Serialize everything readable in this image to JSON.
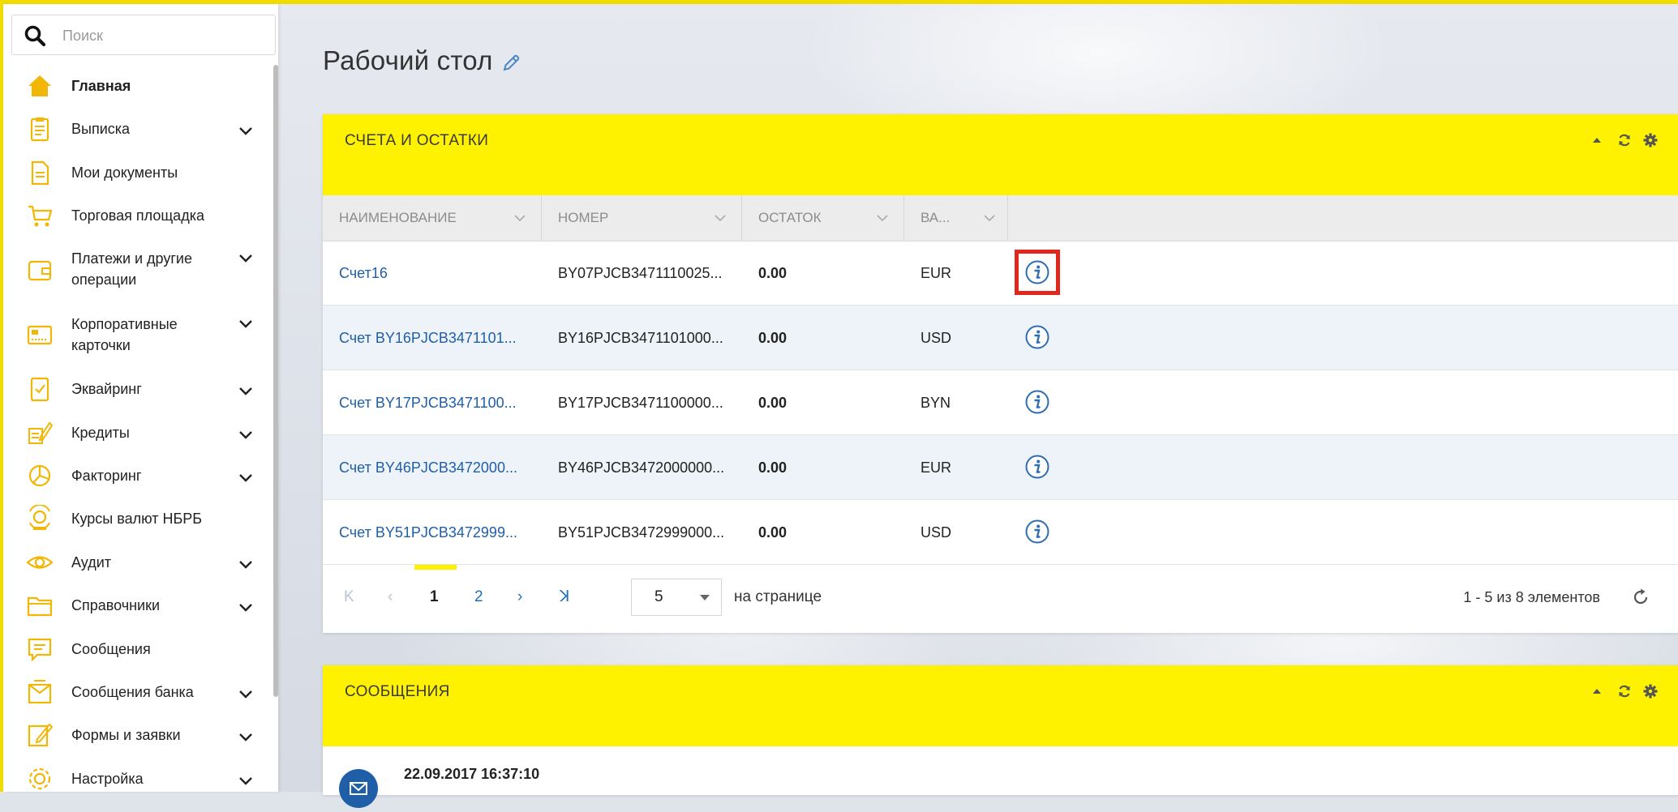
{
  "search": {
    "placeholder": "Поиск"
  },
  "sidebar": {
    "items": [
      {
        "label": "Главная",
        "icon": "home-icon",
        "active": true,
        "chevron": false
      },
      {
        "label": "Выписка",
        "icon": "statement-icon",
        "chevron": true
      },
      {
        "label": "Мои документы",
        "icon": "document-icon",
        "chevron": false
      },
      {
        "label": "Торговая площадка",
        "icon": "cart-icon",
        "chevron": false
      },
      {
        "label": "Платежи и другие операции",
        "icon": "wallet-icon",
        "chevron": true
      },
      {
        "label": "Корпоративные карточки",
        "icon": "card-icon",
        "chevron": true
      },
      {
        "label": "Эквайринг",
        "icon": "acquiring-icon",
        "chevron": true
      },
      {
        "label": "Кредиты",
        "icon": "credit-icon",
        "chevron": true
      },
      {
        "label": "Факторинг",
        "icon": "pie-chart-icon",
        "chevron": true
      },
      {
        "label": "Курсы валют НБРБ",
        "icon": "currency-rates-icon",
        "chevron": false
      },
      {
        "label": "Аудит",
        "icon": "eye-icon",
        "chevron": true
      },
      {
        "label": "Справочники",
        "icon": "folder-icon",
        "chevron": true
      },
      {
        "label": "Сообщения",
        "icon": "message-icon",
        "chevron": false
      },
      {
        "label": "Сообщения банка",
        "icon": "bank-message-icon",
        "chevron": true
      },
      {
        "label": "Формы и заявки",
        "icon": "form-edit-icon",
        "chevron": true
      },
      {
        "label": "Настройка",
        "icon": "settings-gear-icon",
        "chevron": true
      }
    ]
  },
  "page": {
    "title": "Рабочий стол"
  },
  "accounts_widget": {
    "title": "СЧЕТА И ОСТАТКИ",
    "columns": [
      "НАИМЕНОВАНИЕ",
      "НОМЕР",
      "ОСТАТОК",
      "ВА..."
    ],
    "rows": [
      {
        "name": "Счет16",
        "number": "BY07PJCB3471110025...",
        "balance": "0.00",
        "currency": "EUR"
      },
      {
        "name": "Счет BY16PJCB3471101...",
        "number": "BY16PJCB3471101000...",
        "balance": "0.00",
        "currency": "USD"
      },
      {
        "name": "Счет BY17PJCB3471100...",
        "number": "BY17PJCB3471100000...",
        "balance": "0.00",
        "currency": "BYN"
      },
      {
        "name": "Счет BY46PJCB3472000...",
        "number": "BY46PJCB3472000000...",
        "balance": "0.00",
        "currency": "EUR"
      },
      {
        "name": "Счет BY51PJCB3472999...",
        "number": "BY51PJCB3472999000...",
        "balance": "0.00",
        "currency": "USD"
      }
    ],
    "pager": {
      "pages": [
        "1",
        "2"
      ],
      "current": "1",
      "page_size": "5",
      "per_page_label": "на странице",
      "range": "1 - 5 из 8 элементов"
    }
  },
  "messages_widget": {
    "title": "СООБЩЕНИЯ",
    "first_message_date": "22.09.2017 16:37:10"
  },
  "colors": {
    "accent_yellow": "#fff200",
    "link_blue": "#1f5fa8",
    "highlight_red": "#e1261c",
    "icon_gold": "#f2b705"
  }
}
